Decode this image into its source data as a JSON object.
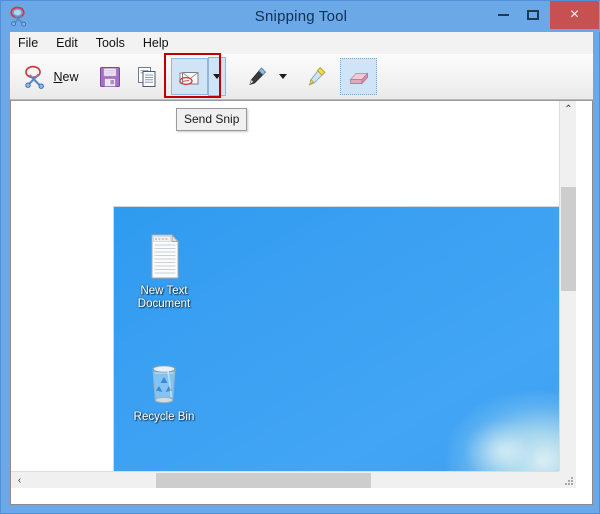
{
  "window": {
    "title": "Snipping Tool",
    "app_icon": "snipping-tool-icon",
    "controls": {
      "minimize": "minimize-icon",
      "maximize": "maximize-icon",
      "close": "close-icon",
      "close_glyph": "×",
      "close_color": "#c75050"
    },
    "titlebar_color": "#6aa8e8"
  },
  "menu": {
    "items": [
      {
        "label": "File"
      },
      {
        "label": "Edit"
      },
      {
        "label": "Tools"
      },
      {
        "label": "Help"
      }
    ]
  },
  "toolbar": {
    "new_label": "New",
    "new_accel": "N",
    "new_rest": "ew",
    "buttons": [
      {
        "name": "new-button",
        "icon": "scissors-icon",
        "label": "New",
        "state": "normal"
      },
      {
        "name": "save-button",
        "icon": "floppy-disk-icon",
        "label": "Save Snip",
        "state": "normal"
      },
      {
        "name": "copy-button",
        "icon": "copy-icon",
        "label": "Copy",
        "state": "normal"
      },
      {
        "name": "send-snip-button",
        "icon": "envelope-icon",
        "label": "Send Snip",
        "state": "hover"
      },
      {
        "name": "send-snip-dropdown",
        "icon": "chevron-down-icon",
        "label": "Send Snip options",
        "state": "hover"
      },
      {
        "name": "pen-button",
        "icon": "pen-icon",
        "label": "Pen",
        "state": "normal"
      },
      {
        "name": "pen-dropdown",
        "icon": "chevron-down-icon",
        "label": "Pen options",
        "state": "normal"
      },
      {
        "name": "highlighter-button",
        "icon": "highlighter-icon",
        "label": "Highlighter",
        "state": "normal"
      },
      {
        "name": "eraser-button",
        "icon": "eraser-icon",
        "label": "Eraser",
        "state": "active"
      }
    ],
    "annotation_color": "#c00000"
  },
  "tooltip": {
    "text": "Send Snip",
    "background": "#f0f0f0",
    "border": "#9a9a9a"
  },
  "canvas": {
    "background": "#ffffff",
    "snip": {
      "wallpaper_color": "#42a5f5",
      "icons": [
        {
          "name": "desktop-icon-new-text-document",
          "icon": "text-document-icon",
          "label_lines": [
            "New Text",
            "Document"
          ]
        },
        {
          "name": "desktop-icon-recycle-bin",
          "icon": "recycle-bin-icon",
          "label_lines": [
            "Recycle Bin"
          ]
        }
      ]
    }
  },
  "scrollbars": {
    "vertical": {
      "up": "⌃",
      "down": "⌄",
      "thumb_position_pct": 22
    },
    "horizontal": {
      "left": "‹",
      "right": "›",
      "thumb_position_pct": 26
    },
    "resize_grip": "resize-grip-icon"
  }
}
